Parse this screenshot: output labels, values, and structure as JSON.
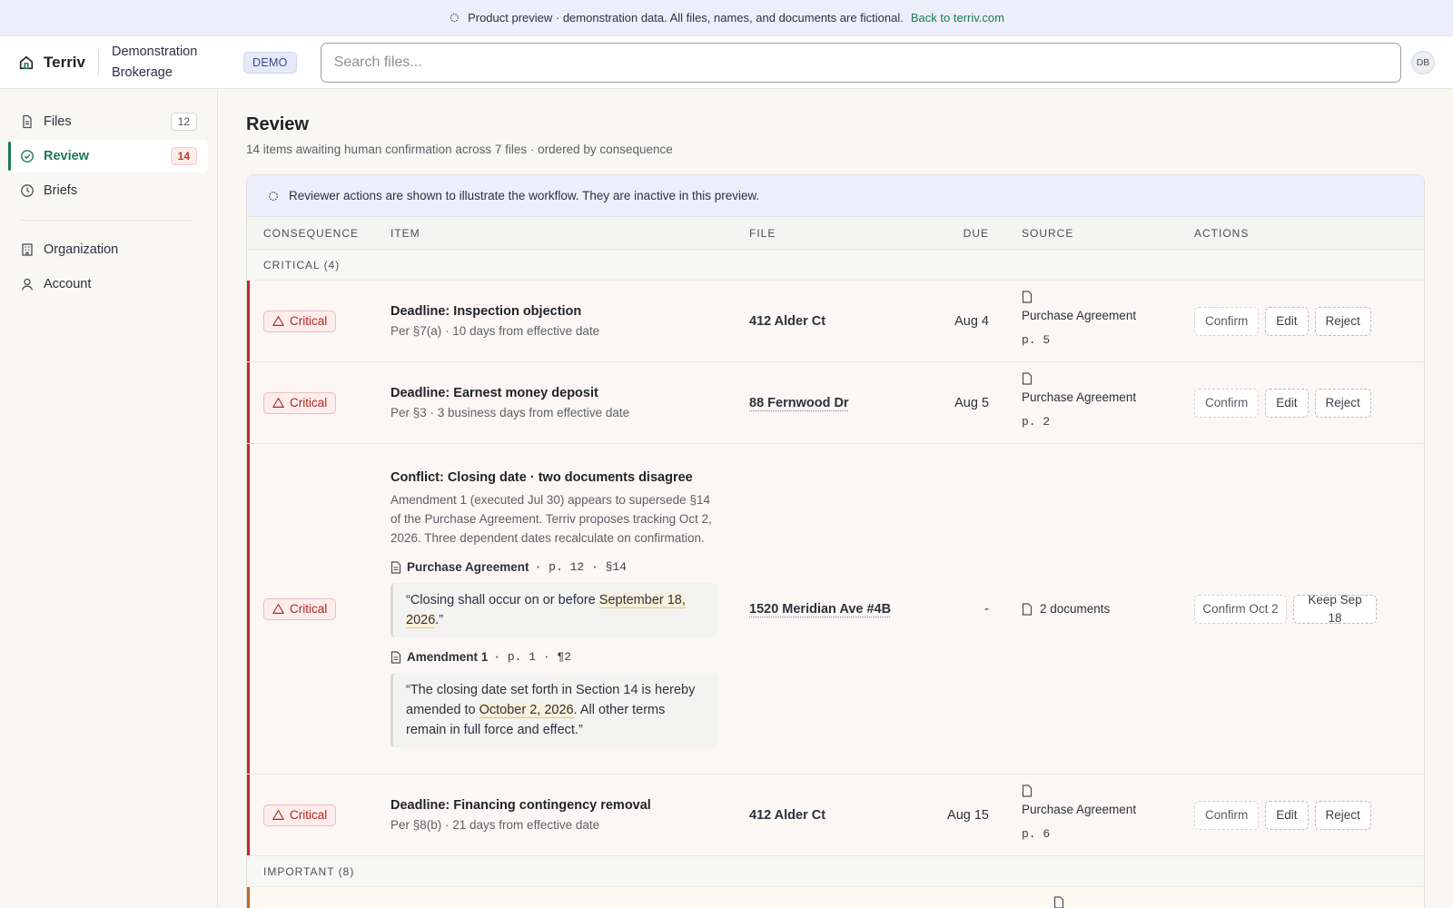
{
  "banner": {
    "text": "Product preview · demonstration data. All files, names, and documents are fictional.",
    "link": "Back to terriv.com"
  },
  "header": {
    "brand": "Terriv",
    "org": "Demonstration Brokerage",
    "badge": "DEMO",
    "search_placeholder": "Search files...",
    "avatar": "DB"
  },
  "sidebar": {
    "items": [
      {
        "label": "Files",
        "count": "12",
        "icon": "file-icon"
      },
      {
        "label": "Review",
        "count": "14",
        "icon": "check-circle-icon",
        "active": true
      },
      {
        "label": "Briefs",
        "icon": "clock-icon"
      },
      {
        "label": "Organization",
        "icon": "building-icon"
      },
      {
        "label": "Account",
        "icon": "user-icon"
      }
    ]
  },
  "page": {
    "title": "Review",
    "subtitle": "14 items awaiting human confirmation across 7 files · ordered by consequence"
  },
  "notice": "Reviewer actions are shown to illustrate the workflow. They are inactive in this preview.",
  "table": {
    "headers": [
      "CONSEQUENCE",
      "ITEM",
      "FILE",
      "DUE",
      "SOURCE",
      "ACTIONS"
    ],
    "groups": {
      "critical": "CRITICAL (4)",
      "important": "IMPORTANT (8)"
    },
    "badge_label": "Critical",
    "buttons": {
      "confirm": "Confirm",
      "edit": "Edit",
      "reject": "Reject",
      "confirm_new": "Confirm Oct 2",
      "keep_old": "Keep Sep 18"
    },
    "rows": [
      {
        "title": "Deadline: Inspection objection",
        "sub": "Per §7(a) · 10 days from effective date",
        "file": "412 Alder Ct",
        "due": "Aug 4",
        "source": "Purchase Agreement",
        "page": "p. 5"
      },
      {
        "title": "Deadline: Earnest money deposit",
        "sub": "Per §3 · 3 business days from effective date",
        "file": "88 Fernwood Dr",
        "due": "Aug 5",
        "source": "Purchase Agreement",
        "page": "p. 2"
      },
      {
        "title": "Deadline: Financing contingency removal",
        "sub": "Per §8(b) · 21 days from effective date",
        "file": "412 Alder Ct",
        "due": "Aug 15",
        "source": "Purchase Agreement",
        "page": "p. 6"
      }
    ],
    "conflict": {
      "title": "Conflict: Closing date · two documents disagree",
      "body": "Amendment 1 (executed Jul 30) appears to supersede §14 of the Purchase Agreement. Terriv proposes tracking Oct 2, 2026. Three dependent dates recalculate on confirmation.",
      "cite1": {
        "doc": "Purchase Agreement",
        "meta": "· p. 12 · §14"
      },
      "quote1": {
        "before": "“Closing shall occur on or before ",
        "highlight": "September 18, 2026",
        "after": ".”"
      },
      "cite2": {
        "doc": "Amendment 1",
        "meta": "· p. 1 · ¶2"
      },
      "quote2": {
        "before": "“The closing date set forth in Section 14 is hereby amended to ",
        "highlight": "October 2, 2026",
        "after": ". All other terms remain in full force and effect.”"
      },
      "file": "1520 Meridian Ave #4B",
      "due": "-",
      "source": "2 documents"
    }
  },
  "colors": {
    "accent": "#1d7a55",
    "critical": "#c62828",
    "important": "#c0661a"
  }
}
